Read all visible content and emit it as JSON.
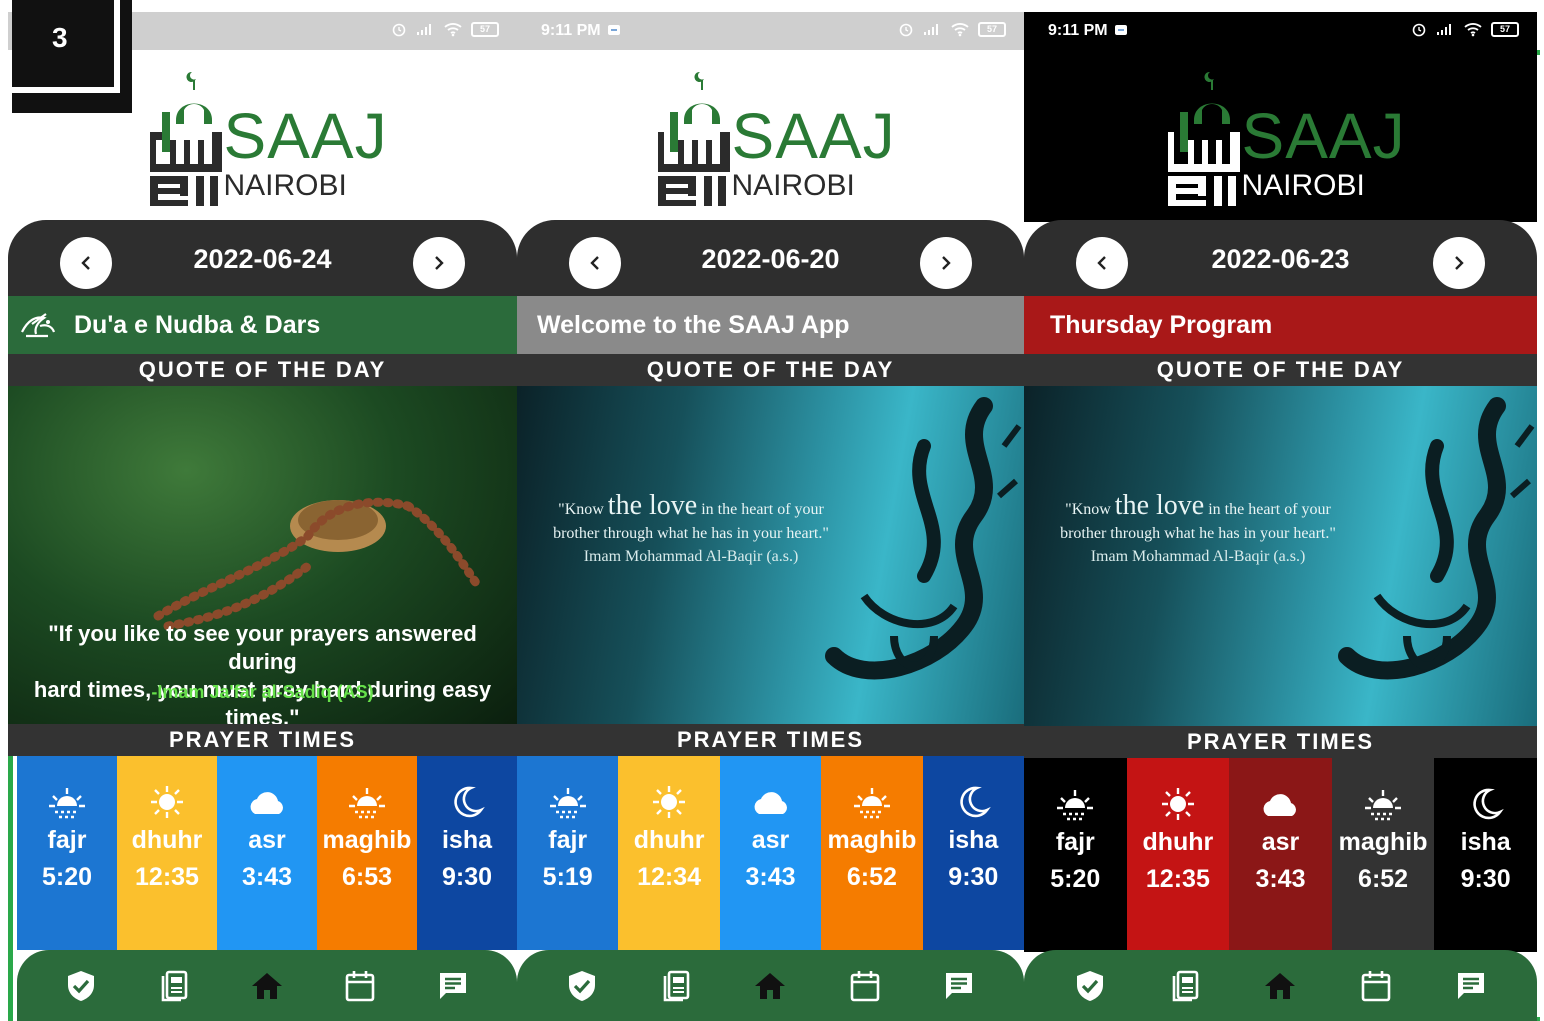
{
  "badge": {
    "number": "3"
  },
  "app": {
    "logo_word": "SAAJ",
    "logo_city": "NAIROBI"
  },
  "labels": {
    "quote_title": "QUOTE OF THE DAY",
    "prayer_title": "PRAYER TIMES"
  },
  "colors": {
    "app_green": "#2b6b3b",
    "accent_line": "#2aa84a",
    "header_dark": "#2e2e2e"
  },
  "nav_icons": [
    "shield-check-icon",
    "book-icon",
    "home-icon",
    "calendar-icon",
    "chat-icon"
  ],
  "screens": [
    {
      "status_time": "",
      "battery": "57",
      "date": "2022-06-24",
      "event": "Du'a e Nudba & Dars",
      "quote_line1": "\"If you like to see your prayers answered during",
      "quote_line2": "hard times, you must pray hard during easy times.\"",
      "quote_author": "-Imam Ja'far al-Sadiq (AS)",
      "prayers": [
        {
          "name": "fajr",
          "time": "5:20",
          "icon": "sunrise-icon",
          "color": "#1c76d2"
        },
        {
          "name": "dhuhr",
          "time": "12:35",
          "icon": "sun-icon",
          "color": "#fbc02d"
        },
        {
          "name": "asr",
          "time": "3:43",
          "icon": "cloud-icon",
          "color": "#2196f3"
        },
        {
          "name": "maghib",
          "time": "6:53",
          "icon": "sunset-icon",
          "color": "#f57c00"
        },
        {
          "name": "isha",
          "time": "9:30",
          "icon": "moon-icon",
          "color": "#0d47a1"
        }
      ]
    },
    {
      "status_time": "9:11 PM",
      "battery": "57",
      "date": "2022-06-20",
      "event": "Welcome to the SAAJ App",
      "quote_pre": "\"Know ",
      "quote_big": "the love",
      "quote_post": " in the heart of your",
      "quote_line2": "brother through what he has in your heart.\"",
      "quote_author": "Imam Mohammad Al-Baqir (a.s.)",
      "prayers": [
        {
          "name": "fajr",
          "time": "5:19",
          "icon": "sunrise-icon",
          "color": "#1c76d2"
        },
        {
          "name": "dhuhr",
          "time": "12:34",
          "icon": "sun-icon",
          "color": "#fbc02d"
        },
        {
          "name": "asr",
          "time": "3:43",
          "icon": "cloud-icon",
          "color": "#2196f3"
        },
        {
          "name": "maghib",
          "time": "6:52",
          "icon": "sunset-icon",
          "color": "#f57c00"
        },
        {
          "name": "isha",
          "time": "9:30",
          "icon": "moon-icon",
          "color": "#0d47a1"
        }
      ]
    },
    {
      "status_time": "9:11 PM",
      "battery": "57",
      "date": "2022-06-23",
      "event": "Thursday Program",
      "quote_pre": "\"Know ",
      "quote_big": "the love",
      "quote_post": " in the heart of your",
      "quote_line2": "brother through what he has in your heart.\"",
      "quote_author": "Imam Mohammad Al-Baqir (a.s.)",
      "prayers": [
        {
          "name": "fajr",
          "time": "5:20",
          "icon": "sunrise-icon",
          "color": "#000000"
        },
        {
          "name": "dhuhr",
          "time": "12:35",
          "icon": "sun-icon",
          "color": "#c41414"
        },
        {
          "name": "asr",
          "time": "3:43",
          "icon": "cloud-icon",
          "color": "#8b1717"
        },
        {
          "name": "maghib",
          "time": "6:52",
          "icon": "sunset-icon",
          "color": "#333333"
        },
        {
          "name": "isha",
          "time": "9:30",
          "icon": "moon-icon",
          "color": "#000000"
        }
      ]
    }
  ]
}
